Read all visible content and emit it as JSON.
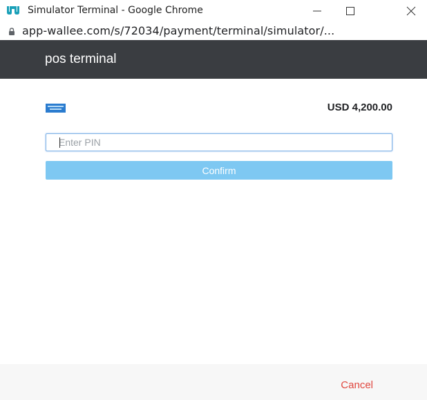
{
  "window": {
    "title": "Simulator Terminal - Google Chrome",
    "app_icon": "wallee-logo-icon",
    "controls": [
      "minimize-icon",
      "maximize-icon",
      "close-icon"
    ]
  },
  "address_bar": {
    "icon": "lock-icon",
    "url": "app-wallee.com/s/72034/payment/terminal/simulator/..."
  },
  "header": {
    "title": "pos terminal"
  },
  "payment": {
    "card_icon": "american-express-card-icon",
    "amount": "USD 4,200.00"
  },
  "pin": {
    "value": "",
    "placeholder": "Enter PIN"
  },
  "actions": {
    "confirm_label": "Confirm",
    "cancel_label": "Cancel"
  },
  "colors": {
    "header_bg": "#3a3d41",
    "confirm_bg": "#7ec8f2",
    "cancel_text": "#e0463e",
    "input_border": "#7fb2e6"
  }
}
